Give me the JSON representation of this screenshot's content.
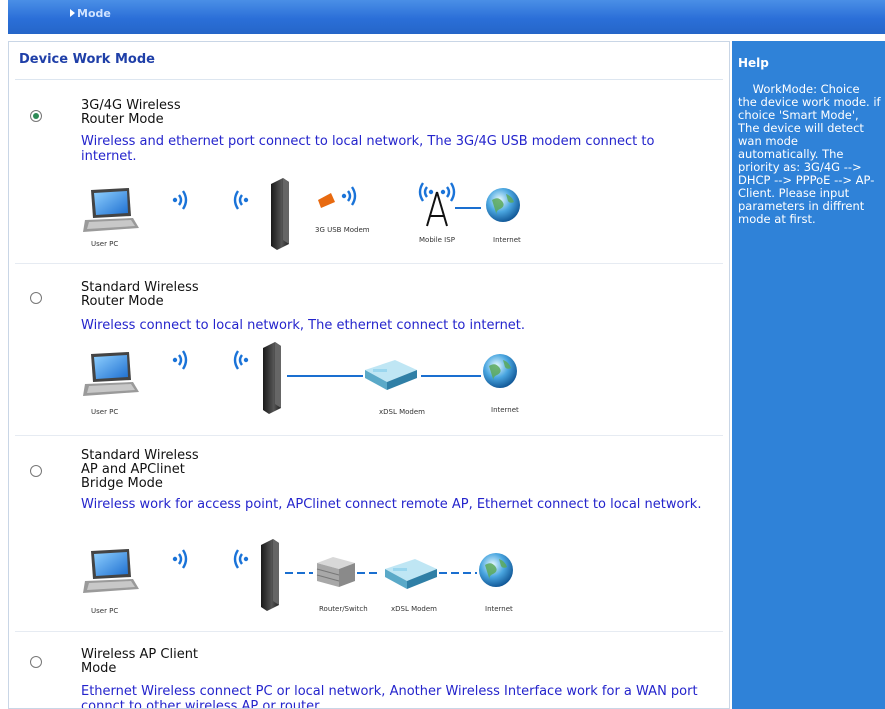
{
  "header": {
    "breadcrumb": "Mode"
  },
  "panel": {
    "title": "Device Work Mode"
  },
  "help": {
    "title": "Help",
    "text": "    WorkMode: Choice the device work mode. if choice 'Smart Mode', The device will detect wan mode automatically. The priority as: 3G/4G --> DHCP --> PPPoE --> AP-Client. Please input parameters in diffrent mode at first."
  },
  "modes": [
    {
      "name_l1": "3G/4G Wireless",
      "name_l2": "Router Mode",
      "name_l3": "",
      "selected": true,
      "description": "Wireless and ethernet port connect to local network, The 3G/4G USB modem connect to internet.",
      "captions": {
        "user_pc": "User PC",
        "modem": "3G USB Modem",
        "isp": "Mobile ISP",
        "internet": "Internet"
      }
    },
    {
      "name_l1": "Standard Wireless",
      "name_l2": "Router Mode",
      "name_l3": "",
      "selected": false,
      "description": "Wireless connect to local network, The ethernet connect to internet.",
      "captions": {
        "user_pc": "User PC",
        "modem": "xDSL Modem",
        "internet": "Internet"
      }
    },
    {
      "name_l1": "Standard Wireless",
      "name_l2": "AP and APClinet",
      "name_l3": "Bridge Mode",
      "selected": false,
      "description": "Wireless work for access point, APClinet connect remote AP, Ethernet connect to local network.",
      "captions": {
        "user_pc": "User PC",
        "router": "Router/Switch",
        "modem": "xDSL Modem",
        "internet": "Internet"
      }
    },
    {
      "name_l1": "Wireless AP Client",
      "name_l2": "Mode",
      "name_l3": "",
      "selected": false,
      "description": "Ethernet Wireless connect PC or local network, Another Wireless Interface work for a WAN port connct to other wireless AP or router."
    }
  ],
  "colors": {
    "accent": "#2f82d8",
    "link_text": "#2424cc",
    "title": "#1f3fa8"
  }
}
